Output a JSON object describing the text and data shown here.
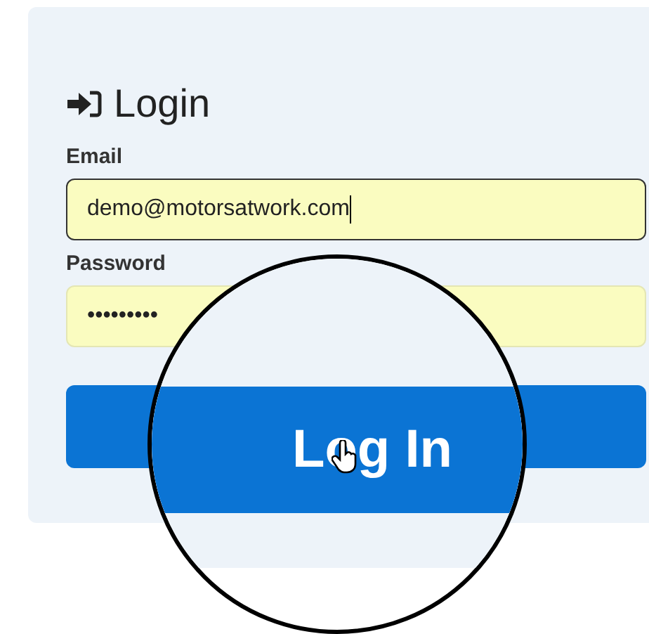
{
  "form": {
    "title": "Login",
    "fields": [
      {
        "label": "Email",
        "value": "demo@motorsatwork.com",
        "focused": true
      },
      {
        "label": "Password",
        "value": "•••••••••",
        "focused": false
      }
    ],
    "submit": {
      "label": "Log In"
    }
  }
}
